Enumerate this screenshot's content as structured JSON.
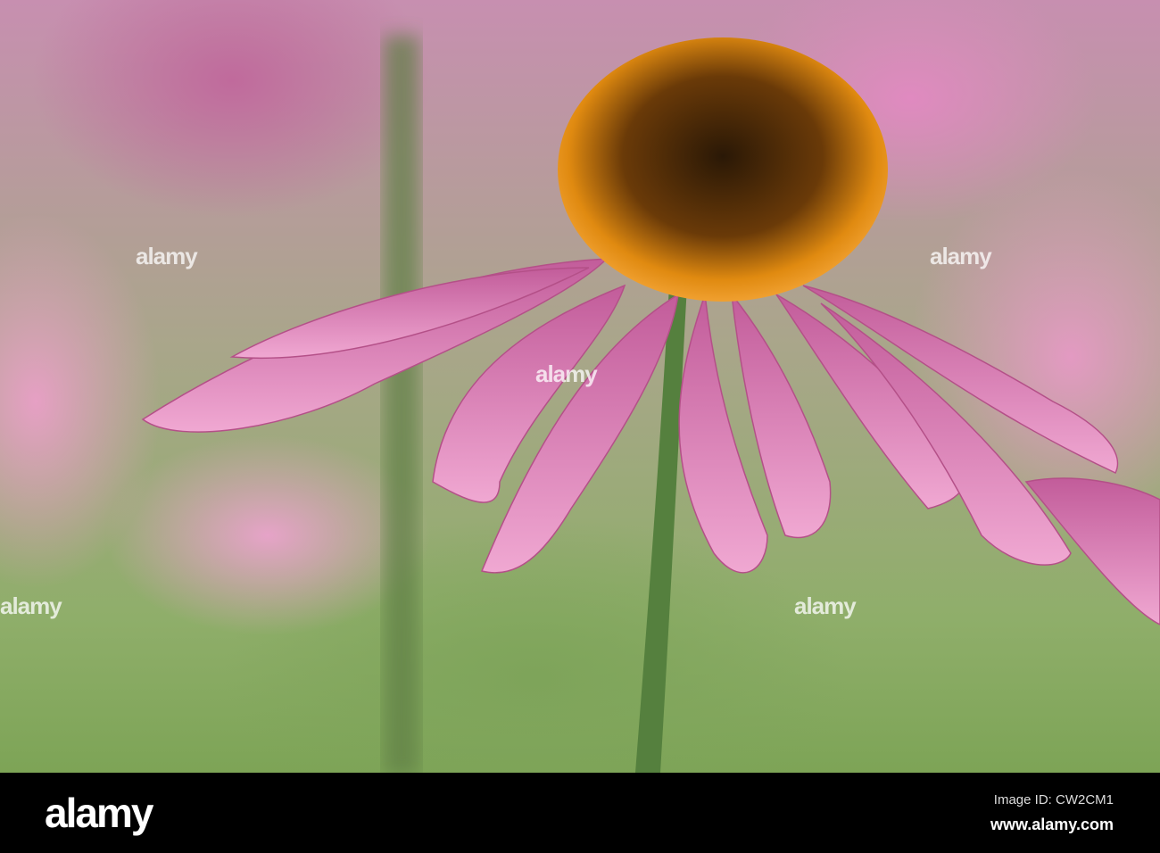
{
  "image": {
    "subject": "coneflower",
    "colors": {
      "petal": "#d97fb6",
      "cone": "#e58a12",
      "stem": "#55803e"
    }
  },
  "watermark": {
    "text": "alamy"
  },
  "footer": {
    "logo": "alamy",
    "image_id": "Image ID: CW2CM1",
    "website": "www.alamy.com"
  }
}
